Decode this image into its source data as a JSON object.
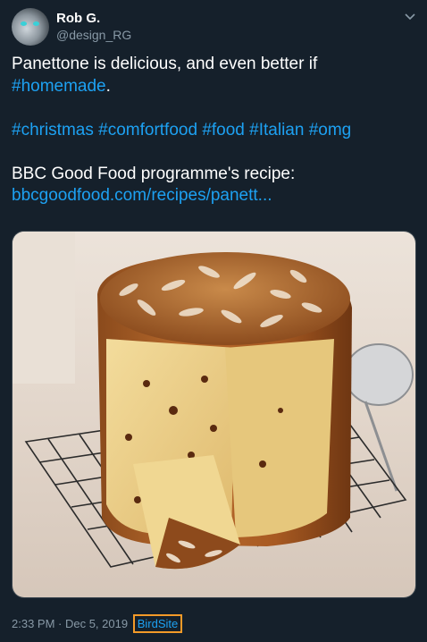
{
  "user": {
    "name": "Rob G.",
    "handle": "@design_RG"
  },
  "tweet": {
    "line1": "Panettone is delicious, and even better if",
    "hashtag_homemade": "#homemade",
    "line1_end": ".",
    "hashtags": [
      "#christmas",
      "#comfortfood",
      "#food",
      "#Italian",
      "#omg"
    ],
    "recipe_label": "BBC Good Food programme's recipe:",
    "link": "bbcgoodfood.com/recipes/panett..."
  },
  "meta": {
    "time": "2:33 PM · Dec 5, 2019",
    "source": "BirdSite"
  },
  "icons": {
    "avatar": "cat-avatar-icon",
    "menu": "chevron-down-icon"
  },
  "colors": {
    "background": "#15202b",
    "link": "#1da1f2",
    "muted": "#8899a6",
    "highlight": "#f39a28"
  }
}
